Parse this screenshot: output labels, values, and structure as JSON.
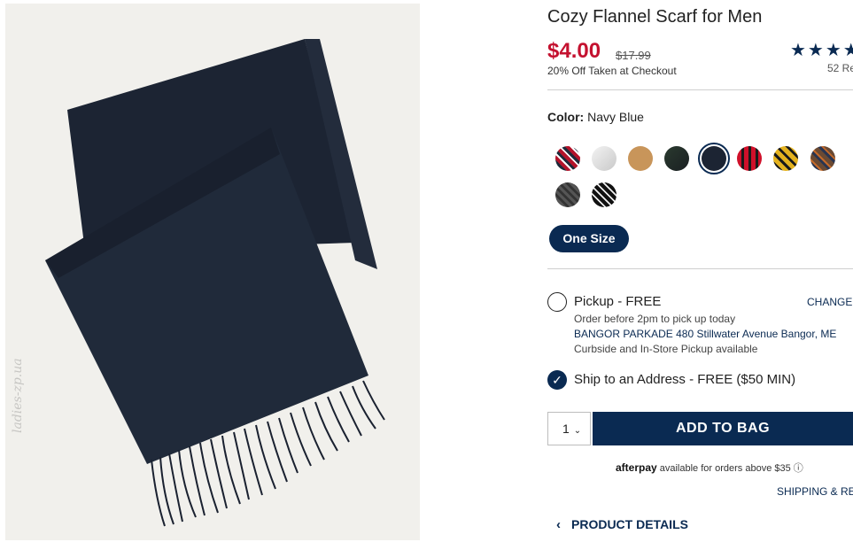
{
  "product": {
    "title": "Cozy Flannel Scarf for Men",
    "price": "$4.00",
    "original_price": "$17.99",
    "discount_note": "20% Off Taken at Checkout",
    "rating_stars": "★★★★",
    "reviews": "52 Re",
    "image_watermark": "ladies-zp.ua"
  },
  "color": {
    "label": "Color:",
    "selected": "Navy Blue",
    "swatches": [
      "red-plaid",
      "light-gray",
      "camel",
      "dark-green",
      "navy-blue",
      "red-buffalo-check",
      "yellow-plaid",
      "brown-plaid",
      "charcoal",
      "black-white-check"
    ]
  },
  "size": {
    "selected": "One Size"
  },
  "fulfillment": {
    "pickup_label": "Pickup - FREE",
    "change_store": "CHANGE S",
    "pickup_note": "Order before 2pm to pick up today",
    "store_address": "BANGOR PARKADE 480 Stillwater Avenue  Bangor, ME",
    "curbside_note": "Curbside and In-Store Pickup available",
    "ship_label": "Ship to an Address - FREE ($50 MIN)",
    "ship_checkmark": "✓"
  },
  "cart": {
    "quantity": "1",
    "quantity_chevron": "⌄",
    "add_to_bag": "ADD TO BAG"
  },
  "afterpay": {
    "brand": "afterpay",
    "text": "available for orders above $35 ⓘ"
  },
  "links": {
    "shipping_returns": "SHIPPING & RET",
    "product_details": "PRODUCT DETAILS",
    "product_details_chevron": "‹"
  },
  "colors": {
    "brand_navy": "#0a2a52",
    "sale_red": "#c4112f"
  }
}
